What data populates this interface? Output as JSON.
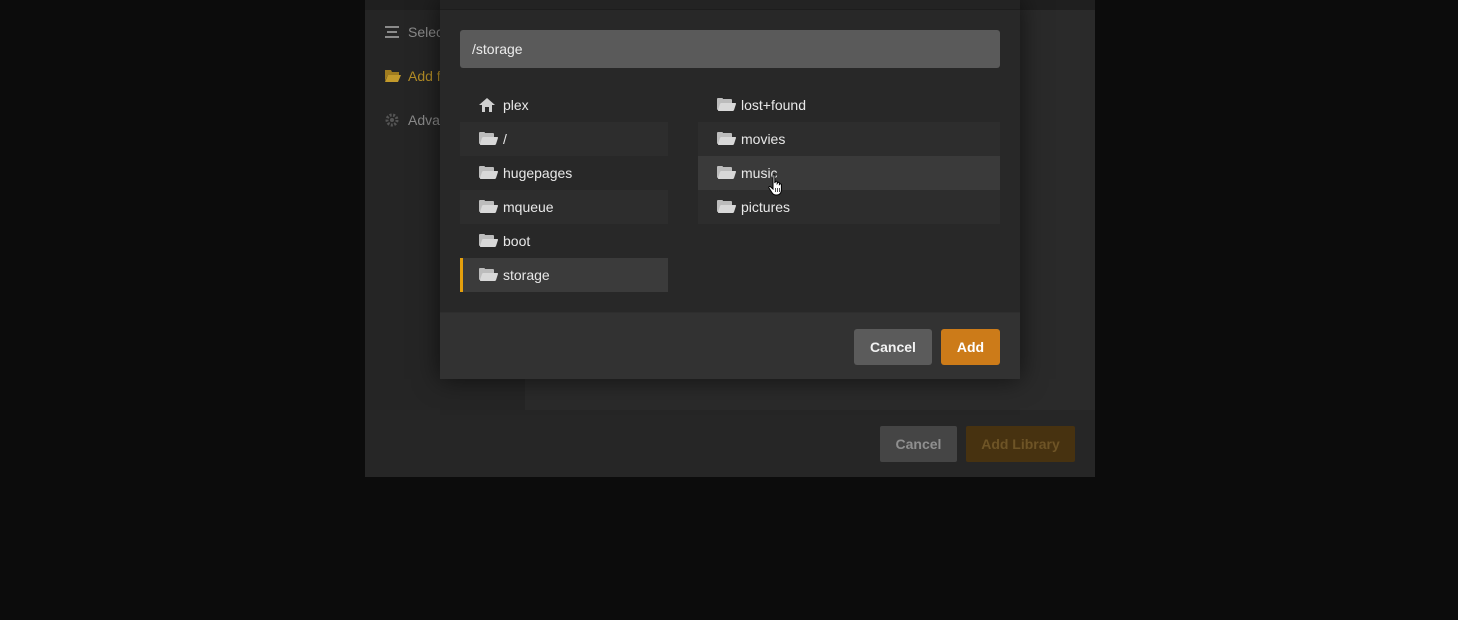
{
  "background_dialog": {
    "nav": [
      {
        "label": "Selec",
        "icon": "list-icon",
        "active": false
      },
      {
        "label": "Add f",
        "icon": "folder-icon",
        "active": true
      },
      {
        "label": "Adva",
        "icon": "gear-icon",
        "active": false
      }
    ],
    "cancel_label": "Cancel",
    "add_library_label": "Add Library"
  },
  "picker": {
    "path_value": "/storage",
    "left_column": [
      {
        "label": "plex",
        "icon": "home-icon"
      },
      {
        "label": "/",
        "icon": "folder-icon"
      },
      {
        "label": "hugepages",
        "icon": "folder-icon"
      },
      {
        "label": "mqueue",
        "icon": "folder-icon"
      },
      {
        "label": "boot",
        "icon": "folder-icon"
      },
      {
        "label": "storage",
        "icon": "folder-icon",
        "selected": true
      }
    ],
    "right_column": [
      {
        "label": "lost+found",
        "icon": "folder-icon"
      },
      {
        "label": "movies",
        "icon": "folder-icon"
      },
      {
        "label": "music",
        "icon": "folder-icon",
        "hovered": true
      },
      {
        "label": "pictures",
        "icon": "folder-icon"
      }
    ],
    "cancel_label": "Cancel",
    "add_label": "Add"
  },
  "colors": {
    "accent": "#e5a00d",
    "add_button": "#cc7b19",
    "modal_bg": "#282828",
    "page_bg": "#0c0c0c"
  }
}
